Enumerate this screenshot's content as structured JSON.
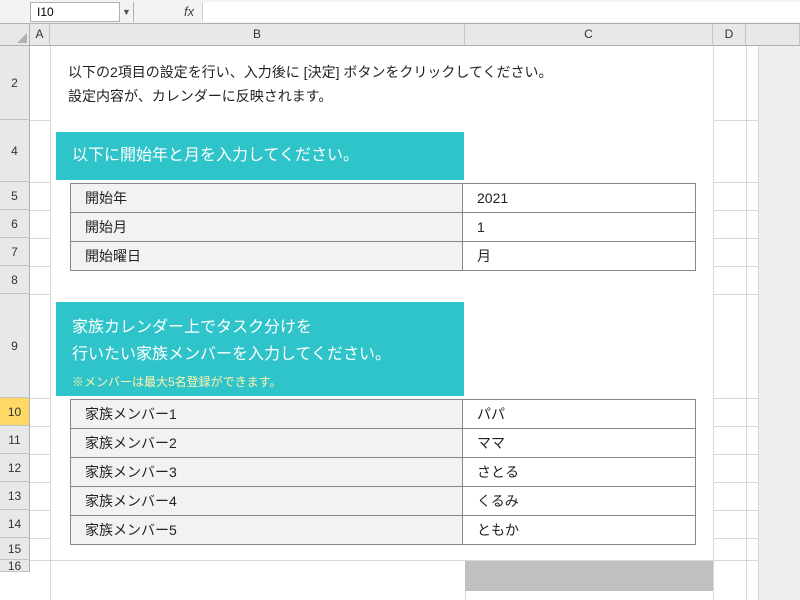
{
  "nameBox": "I10",
  "fxLabel": "fx",
  "formulaValue": "",
  "columns": [
    "A",
    "B",
    "C",
    "D",
    ""
  ],
  "rows": [
    "2",
    "4",
    "5",
    "6",
    "7",
    "8",
    "9",
    "10",
    "11",
    "12",
    "13",
    "14",
    "15",
    "16"
  ],
  "activeRow": "10",
  "instructions": {
    "line1": "以下の2項目の設定を行い、入力後に [決定] ボタンをクリックしてください。",
    "line2": "設定内容が、カレンダーに反映されます。"
  },
  "section1": {
    "heading": "以下に開始年と月を入力してください。",
    "rows": [
      {
        "label": "開始年",
        "value": "2021"
      },
      {
        "label": "開始月",
        "value": "1"
      },
      {
        "label": "開始曜日",
        "value": "月"
      }
    ]
  },
  "section2": {
    "heading1": "家族カレンダー上でタスク分けを",
    "heading2": "行いたい家族メンバーを入力してください。",
    "note": "※メンバーは最大5名登録ができます。",
    "rows": [
      {
        "label": "家族メンバー1",
        "value": "パパ"
      },
      {
        "label": "家族メンバー2",
        "value": "ママ"
      },
      {
        "label": "家族メンバー3",
        "value": "さとる"
      },
      {
        "label": "家族メンバー4",
        "value": "くるみ"
      },
      {
        "label": "家族メンバー5",
        "value": "ともか"
      }
    ]
  }
}
